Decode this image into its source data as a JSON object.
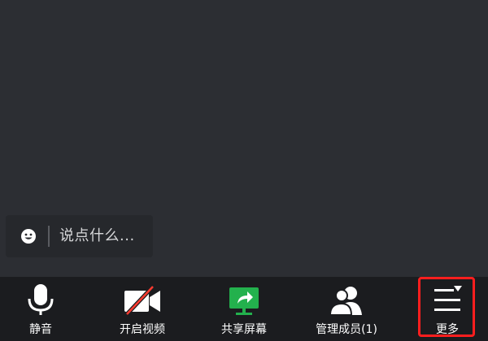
{
  "chat": {
    "placeholder": "说点什么..."
  },
  "toolbar": {
    "items": [
      {
        "label": "静音",
        "icon": "microphone-icon"
      },
      {
        "label": "开启视频",
        "icon": "video-off-icon"
      },
      {
        "label": "共享屏幕",
        "icon": "share-screen-icon"
      },
      {
        "label": "管理成员(1)",
        "icon": "members-icon"
      },
      {
        "label": "更多",
        "icon": "more-menu-icon"
      }
    ]
  },
  "colors": {
    "stage_background": "#2c2e33",
    "toolbar_background": "#1b1c1f",
    "share_accent": "#23b14d",
    "video_off_slash": "#ff3b30",
    "highlight_border": "#ff1e1e"
  }
}
